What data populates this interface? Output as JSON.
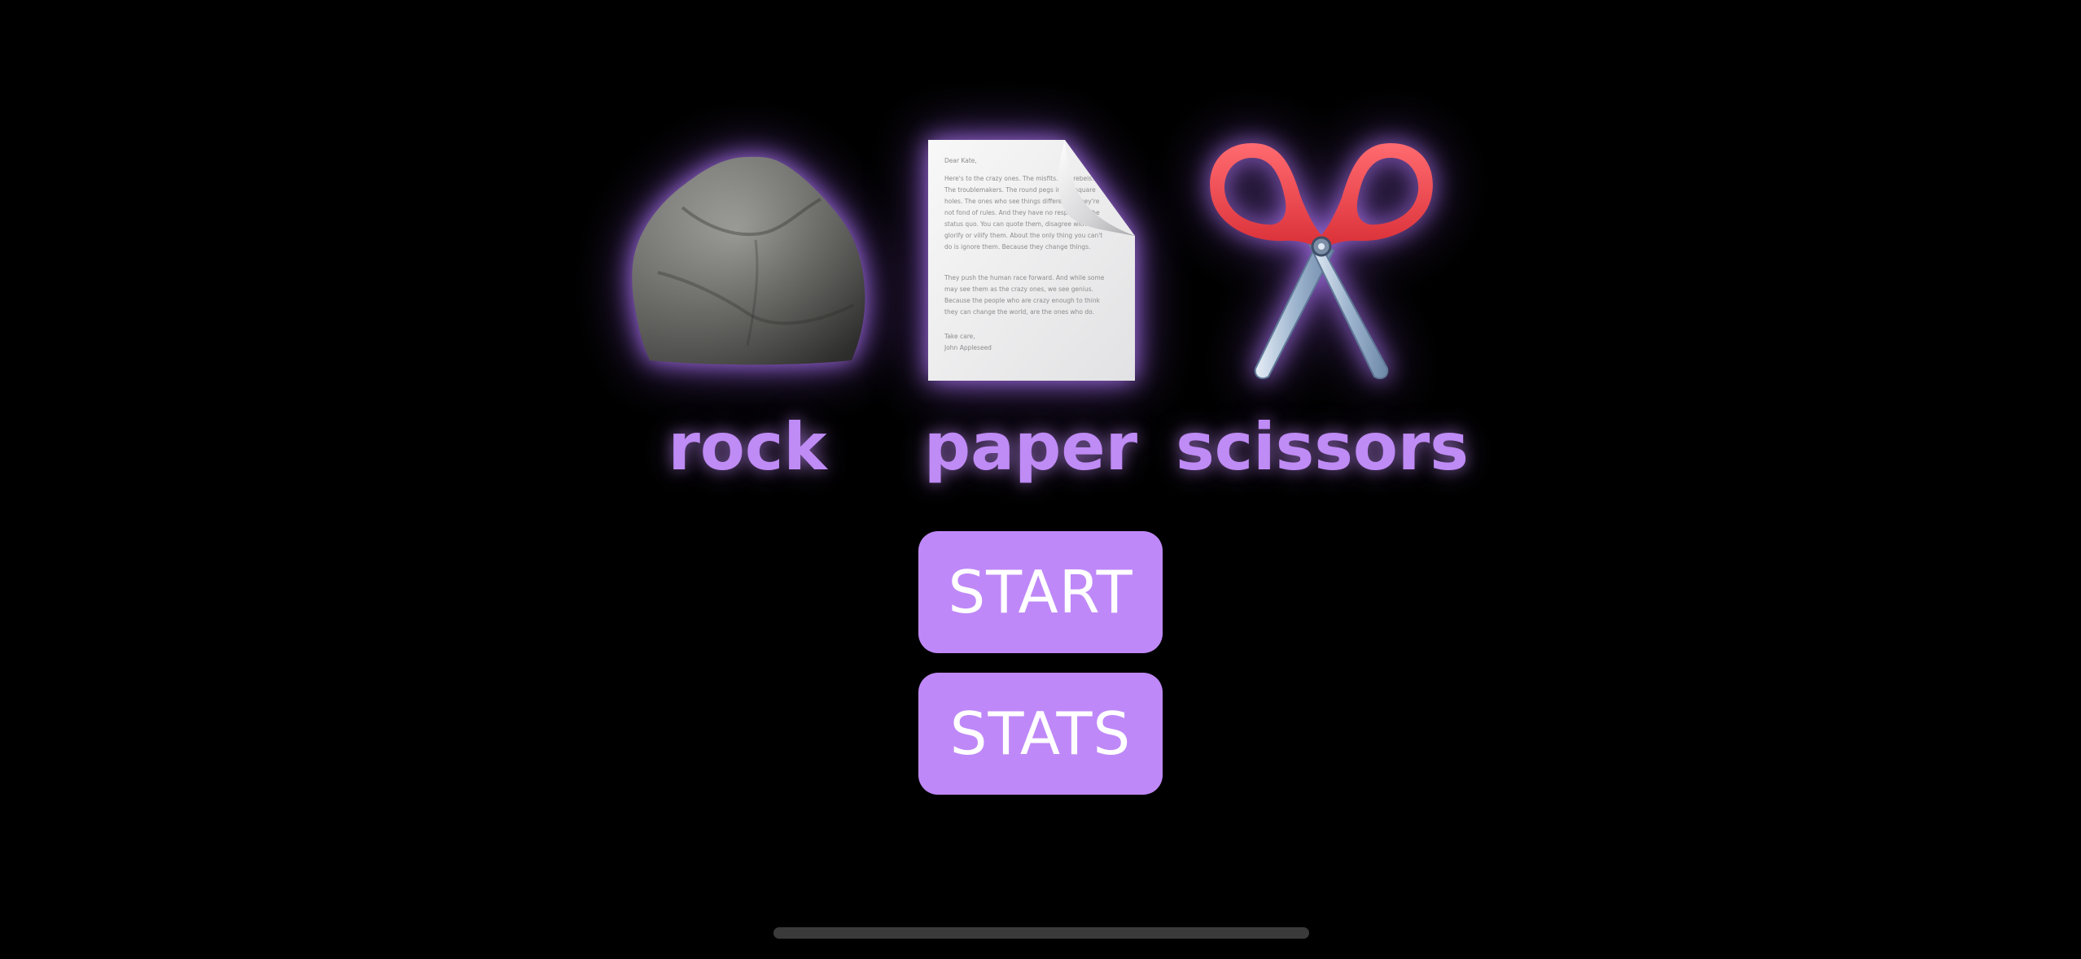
{
  "choices": [
    {
      "id": "rock",
      "label": "rock",
      "icon": "rock-icon"
    },
    {
      "id": "paper",
      "label": "paper",
      "icon": "paper-document-icon"
    },
    {
      "id": "scissors",
      "label": "scissors",
      "icon": "scissors-icon"
    }
  ],
  "document_text": {
    "greeting": "Dear Kate,",
    "lines": [
      "Here's to the crazy ones. The misfits. The rebels.",
      "The troublemakers. The round pegs in the square",
      "holes. The ones who see things differently. They're",
      "not fond of rules. And they have no respect for the",
      "status quo. You can quote them, disagree with them,",
      "glorify or vilify them. About the only thing you can't",
      "do is ignore them. Because they change things.",
      "",
      "They push the human race forward. And while some",
      "may see them as the crazy ones, we see genius.",
      "Because the people who are crazy enough to think",
      "they can change the world, are the ones who do.",
      "",
      "Take care,",
      "John Appleseed"
    ]
  },
  "buttons": {
    "start": "START",
    "stats": "STATS"
  },
  "colors": {
    "accent": "#BF88F8",
    "label": "#BF8BF5",
    "background": "#000000",
    "button_text": "#FFFFFF"
  }
}
